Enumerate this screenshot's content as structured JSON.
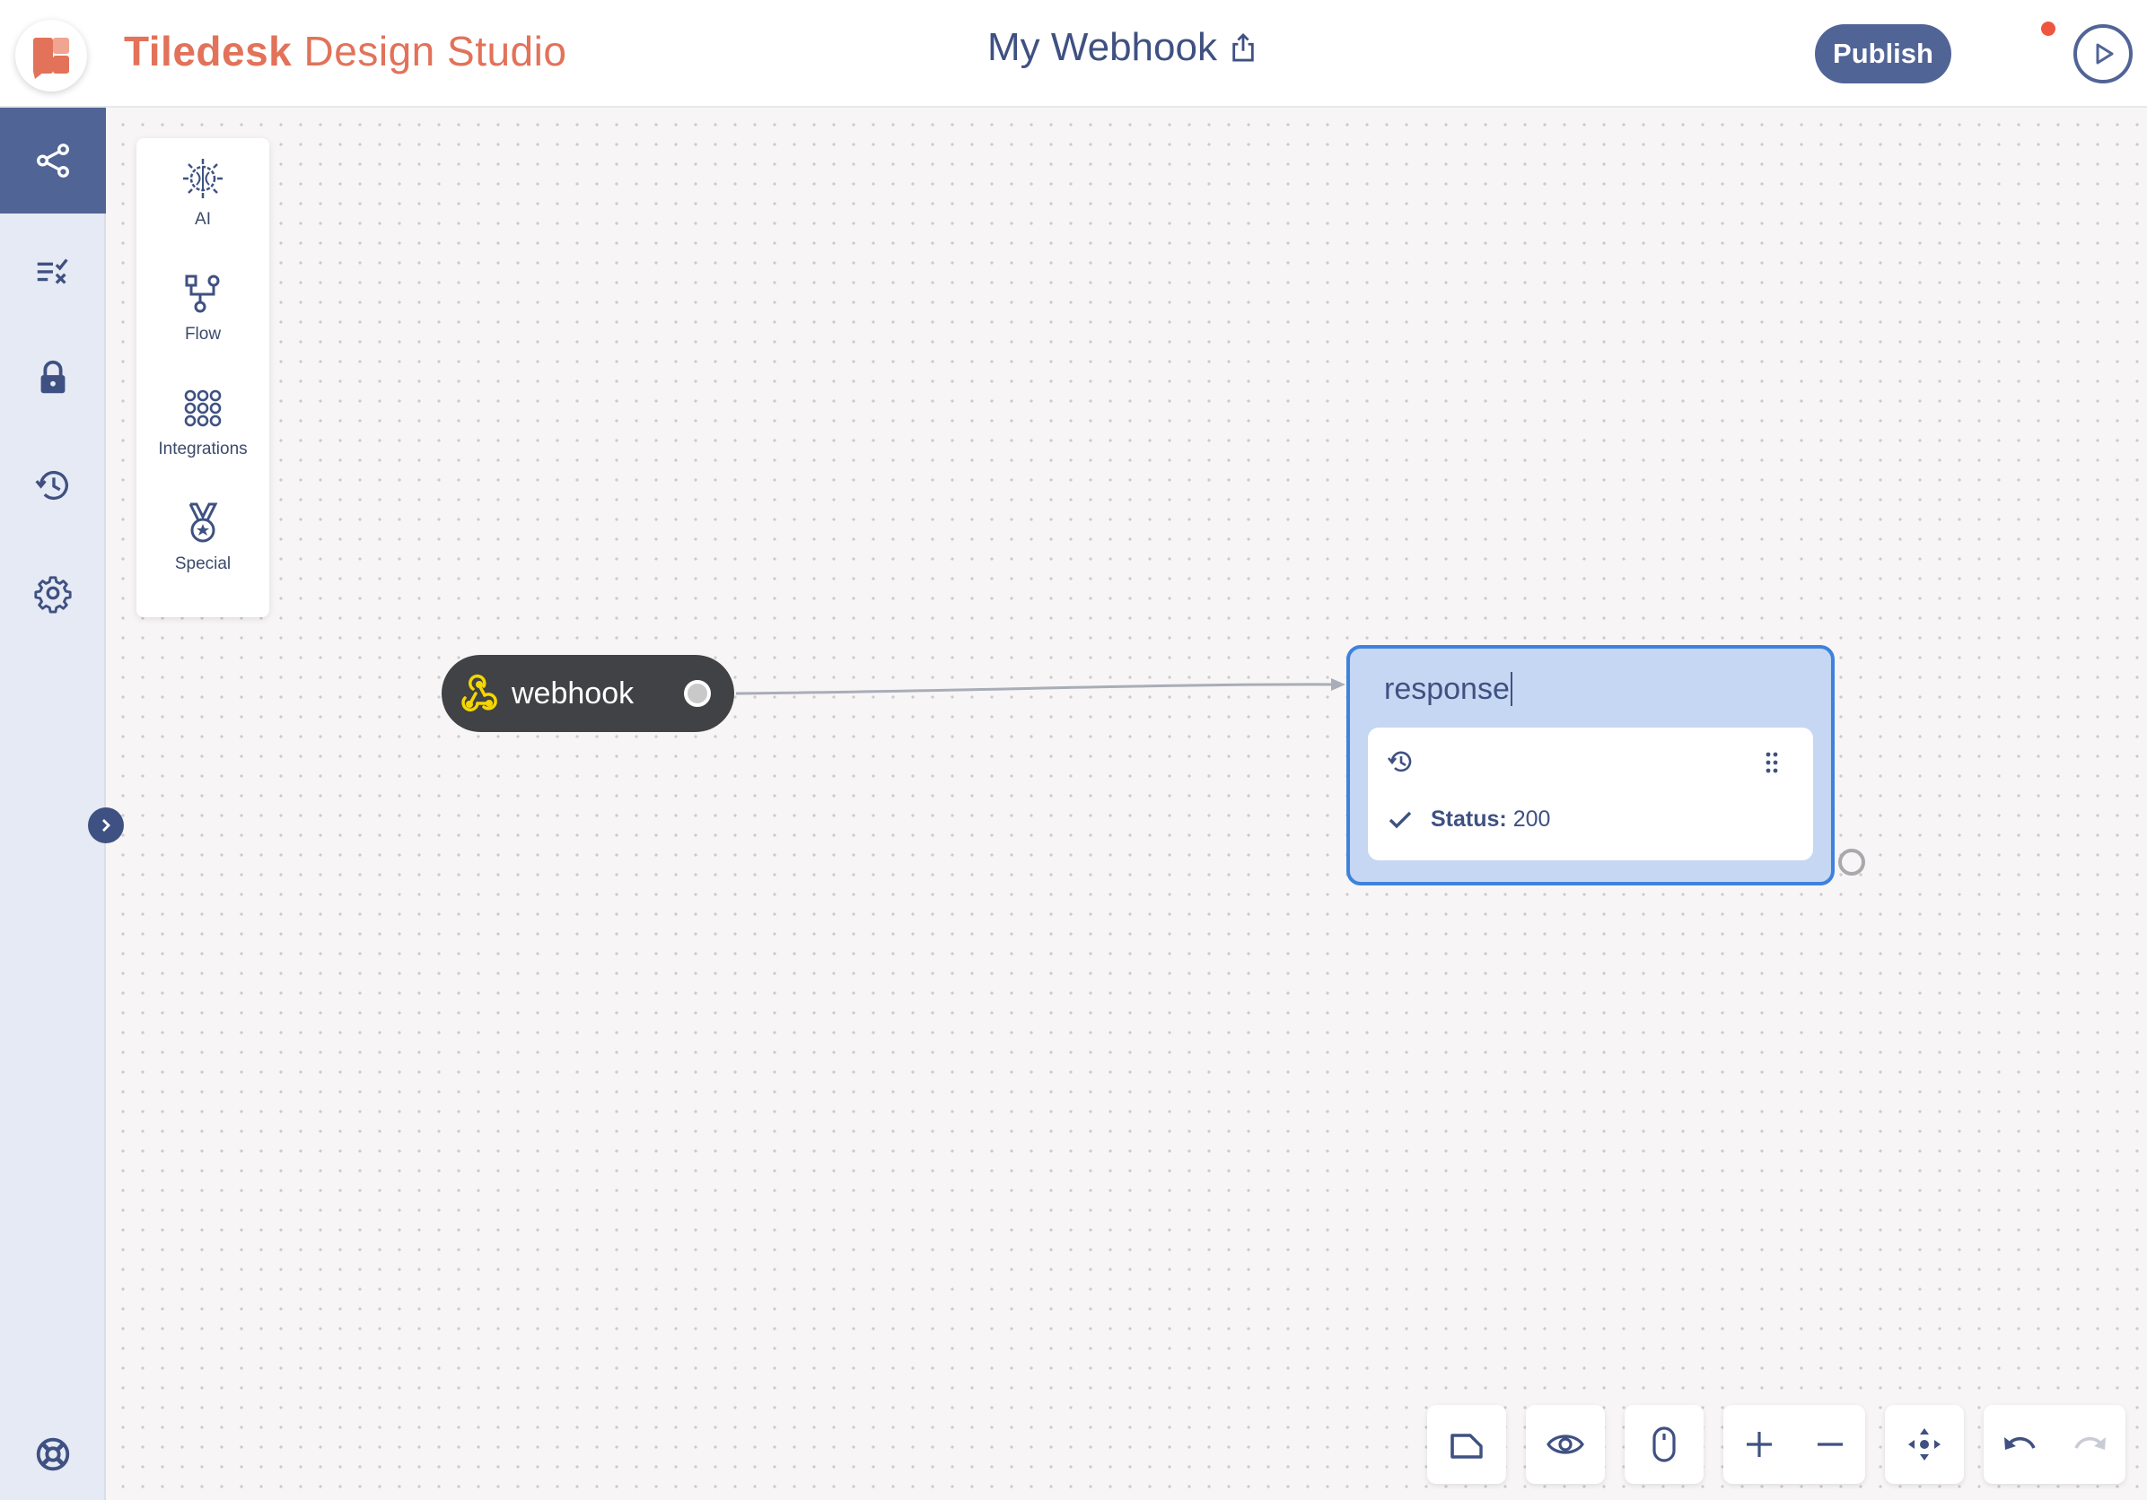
{
  "brand": {
    "bold": "Tiledesk",
    "light": "Design Studio"
  },
  "header": {
    "bot_title": "My Webhook",
    "publish_label": "Publish"
  },
  "palette": {
    "items": [
      {
        "label": "AI"
      },
      {
        "label": "Flow"
      },
      {
        "label": "Integrations"
      },
      {
        "label": "Special"
      }
    ]
  },
  "nodes": {
    "webhook": {
      "label": "webhook"
    },
    "response": {
      "title": "response",
      "status_label": "Status:",
      "status_value": "200"
    }
  },
  "colors": {
    "accent": "#516496",
    "brand": "#e27259",
    "selection": "#3f82dc",
    "notification": "#f0563f",
    "webhook_icon": "#f5d600"
  },
  "icons": {
    "sidebar": [
      "share-icon",
      "checklist-icon",
      "lock-icon",
      "history-icon",
      "gear-icon",
      "support-icon"
    ],
    "toolbar": [
      "note-icon",
      "eye-icon",
      "mouse-icon",
      "zoom-in-icon",
      "zoom-out-icon",
      "fit-center-icon",
      "undo-icon",
      "redo-icon"
    ]
  }
}
